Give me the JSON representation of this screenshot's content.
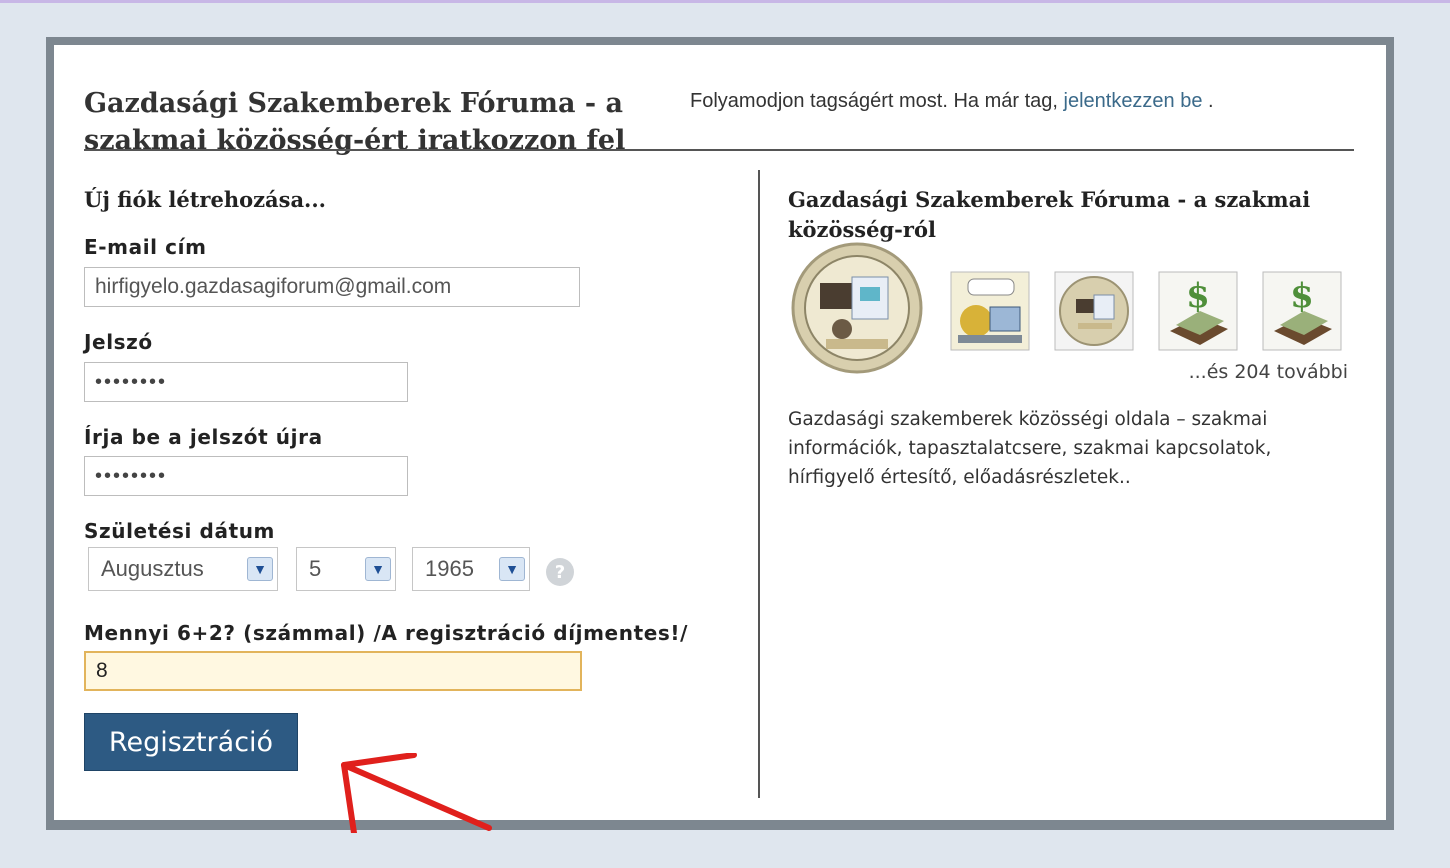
{
  "header": {
    "site_title": "Gazdasági Szakemberek Fóruma - a szakmai közösség-ért iratkozzon fel",
    "join_prefix": "Folyamodjon tagságért most. Ha már tag, ",
    "login_link": "jelentkezzen be",
    "join_suffix": " ."
  },
  "form": {
    "section_title": "Új fiók létrehozása...",
    "email_label": "E-mail cím",
    "email_value": "hirfigyelo.gazdasagiforum@gmail.com",
    "password_label": "Jelszó",
    "password_value": "••••••••",
    "password_confirm_label": "Írja be a jelszót újra",
    "password_confirm_value": "••••••••",
    "birthdate_label": "Születési dátum",
    "birth_month": "Augusztus",
    "birth_day": "5",
    "birth_year": "1965",
    "help_icon": "?",
    "captcha_label": "Mennyi 6+2? (számmal) /A regisztráció díjmentes!/",
    "captcha_value": "8",
    "submit_label": "Regisztráció"
  },
  "about": {
    "title": "Gazdasági Szakemberek Fóruma - a szakmai közösség-ról",
    "more_members": "...és 204 további",
    "description": "Gazdasági szakemberek közösségi oldala – szakmai információk, tapasztalatcsere, szakmai kapcsolatok, hírfigyelő értesítő, előadásrészletek.."
  },
  "colors": {
    "button": "#2d5a83",
    "link": "#3b6a8a",
    "focused_input": "#fff8e1",
    "annotation_arrow": "#e0201c"
  }
}
